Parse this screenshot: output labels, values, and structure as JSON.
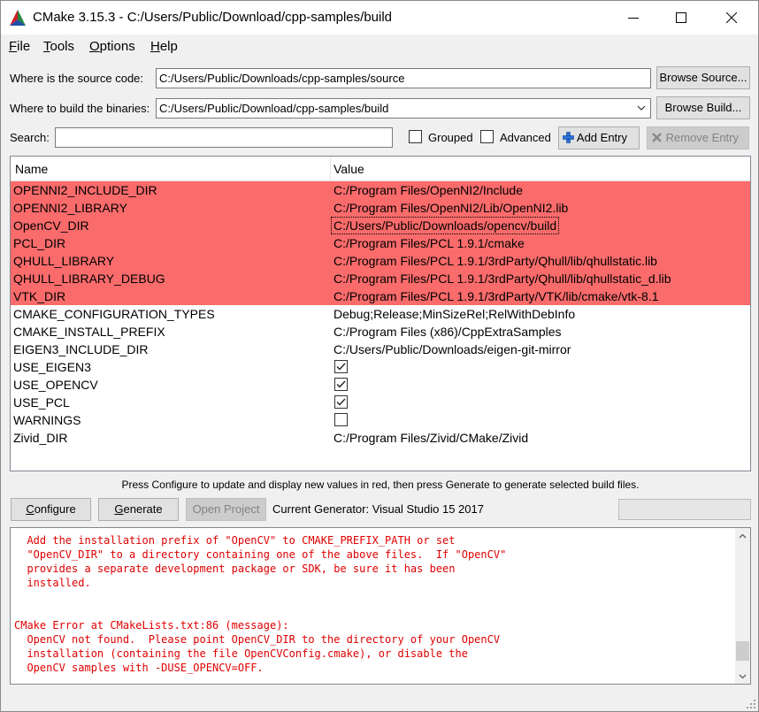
{
  "window": {
    "title": "CMake 3.15.3 - C:/Users/Public/Download/cpp-samples/build"
  },
  "menu": [
    {
      "key": "F",
      "rest": "ile"
    },
    {
      "key": "T",
      "rest": "ools"
    },
    {
      "key": "O",
      "rest": "ptions"
    },
    {
      "key": "H",
      "rest": "elp"
    }
  ],
  "source": {
    "label": "Where is the source code:",
    "value": "C:/Users/Public/Downloads/cpp-samples/source",
    "browse_label": "Browse Source..."
  },
  "build": {
    "label": "Where to build the binaries:",
    "value": "C:/Users/Public/Download/cpp-samples/build",
    "browse_label": "Browse Build..."
  },
  "search": {
    "label": "Search:",
    "value": "",
    "grouped_label": "Grouped",
    "grouped_checked": false,
    "advanced_label": "Advanced",
    "advanced_checked": false,
    "add_entry_label": "Add Entry",
    "remove_entry_label": "Remove Entry"
  },
  "table": {
    "columns": [
      "Name",
      "Value"
    ],
    "rows": [
      {
        "name": "OPENNI2_INCLUDE_DIR",
        "value": "C:/Program Files/OpenNI2/Include",
        "new": true,
        "type": "text"
      },
      {
        "name": "OPENNI2_LIBRARY",
        "value": "C:/Program Files/OpenNI2/Lib/OpenNI2.lib",
        "new": true,
        "type": "text"
      },
      {
        "name": "OpenCV_DIR",
        "value": "C:/Users/Public/Downloads/opencv/build",
        "new": true,
        "type": "text",
        "focused": true
      },
      {
        "name": "PCL_DIR",
        "value": "C:/Program Files/PCL 1.9.1/cmake",
        "new": true,
        "type": "text"
      },
      {
        "name": "QHULL_LIBRARY",
        "value": "C:/Program Files/PCL 1.9.1/3rdParty/Qhull/lib/qhullstatic.lib",
        "new": true,
        "type": "text"
      },
      {
        "name": "QHULL_LIBRARY_DEBUG",
        "value": "C:/Program Files/PCL 1.9.1/3rdParty/Qhull/lib/qhullstatic_d.lib",
        "new": true,
        "type": "text"
      },
      {
        "name": "VTK_DIR",
        "value": "C:/Program Files/PCL 1.9.1/3rdParty/VTK/lib/cmake/vtk-8.1",
        "new": true,
        "type": "text"
      },
      {
        "name": "CMAKE_CONFIGURATION_TYPES",
        "value": "Debug;Release;MinSizeRel;RelWithDebInfo",
        "new": false,
        "type": "text"
      },
      {
        "name": "CMAKE_INSTALL_PREFIX",
        "value": "C:/Program Files (x86)/CppExtraSamples",
        "new": false,
        "type": "text"
      },
      {
        "name": "EIGEN3_INCLUDE_DIR",
        "value": "C:/Users/Public/Downloads/eigen-git-mirror",
        "new": false,
        "type": "text"
      },
      {
        "name": "USE_EIGEN3",
        "value": "",
        "new": false,
        "type": "bool",
        "checked": true
      },
      {
        "name": "USE_OPENCV",
        "value": "",
        "new": false,
        "type": "bool",
        "checked": true
      },
      {
        "name": "USE_PCL",
        "value": "",
        "new": false,
        "type": "bool",
        "checked": true
      },
      {
        "name": "WARNINGS",
        "value": "",
        "new": false,
        "type": "bool",
        "checked": false
      },
      {
        "name": "Zivid_DIR",
        "value": "C:/Program Files/Zivid/CMake/Zivid",
        "new": false,
        "type": "text"
      }
    ]
  },
  "hint": "Press Configure to update and display new values in red, then press Generate to generate selected build files.",
  "actions": {
    "configure_label": "Configure",
    "generate_label": "Generate",
    "open_project_label": "Open Project",
    "generator_text": "Current Generator: Visual Studio 15 2017"
  },
  "log": {
    "text": "  Add the installation prefix of \"OpenCV\" to CMAKE_PREFIX_PATH or set\n  \"OpenCV_DIR\" to a directory containing one of the above files.  If \"OpenCV\"\n  provides a separate development package or SDK, be sure it has been\n  installed.\n\n\nCMake Error at CMakeLists.txt:86 (message):\n  OpenCV not found.  Please point OpenCV_DIR to the directory of your OpenCV\n  installation (containing the file OpenCVConfig.cmake), or disable the\n  OpenCV samples with -DUSE_OPENCV=OFF."
  },
  "colors": {
    "new_entry_bg": "#fa6b6b",
    "error_text": "#e00000"
  }
}
